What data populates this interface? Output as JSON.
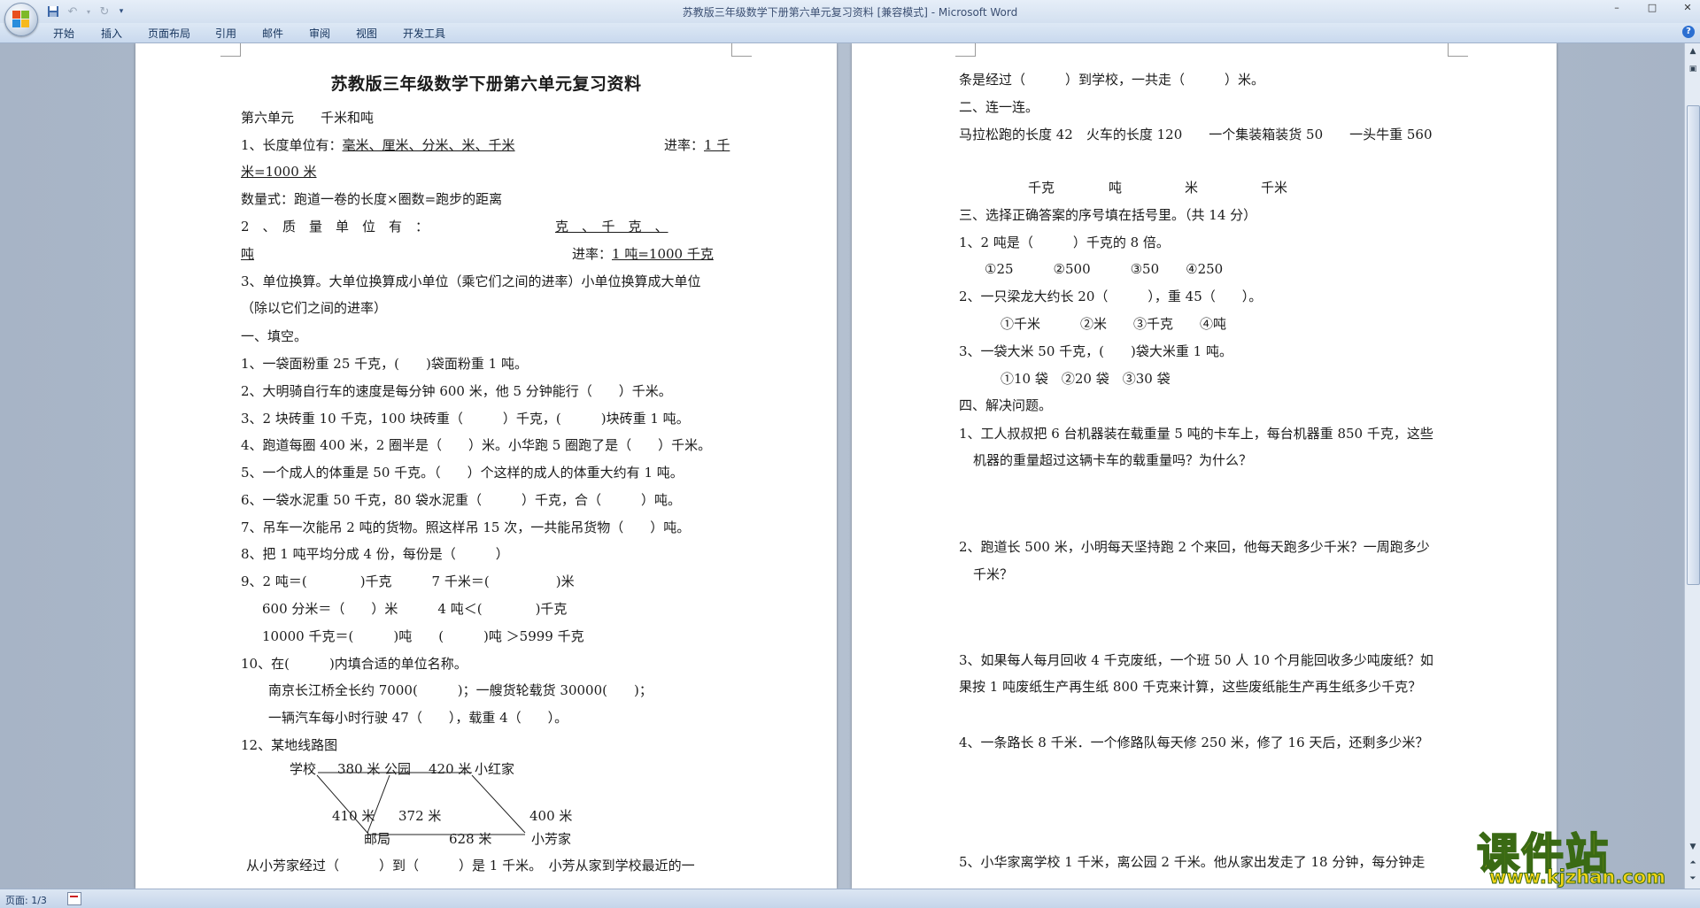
{
  "window": {
    "title": "苏教版三年级数学下册第六单元复习资料 [兼容模式] - Microsoft Word",
    "controls": [
      "–",
      "□",
      "✕"
    ]
  },
  "ribbon": {
    "tabs": [
      "开始",
      "插入",
      "页面布局",
      "引用",
      "邮件",
      "审阅",
      "视图",
      "开发工具"
    ],
    "help_icon": "?"
  },
  "qat": {
    "save_icon": "save-icon",
    "undo_icon": "undo-icon",
    "redo_icon": "redo-icon",
    "more_icon": "customize-icon"
  },
  "status": {
    "page": "页面: 1/3"
  },
  "watermark": {
    "brand": "课件站",
    "url": "www.kjzhan.com"
  },
  "page1": {
    "title": "苏教版三年级数学下册第六单元复习资料",
    "unit_heading": "第六单元　　千米和吨",
    "len_units_label": "1、长度单位有：",
    "len_units": "毫米、厘米、分米、米、千米",
    "len_rate_label": "进率：",
    "len_rate_a": "1 千",
    "len_rate_b": "米=1000 米",
    "formula": "数量式：跑道一卷的长度×圈数=跑步的距离",
    "mass_prefix": "2　、　质　量　单　位　有　：",
    "mass_units_a": "克　、　千　克　、",
    "mass_units_b": "吨",
    "mass_rate_label": "进率：",
    "mass_rate": "1 吨=1000 千克",
    "conv_a": "3、单位换算。大单位换算成小单位（乘它们之间的进率）小单位换算成大单位",
    "conv_b": "（除以它们之间的进率）",
    "sec1": "一、填空。",
    "q1": "1、一袋面粉重 25 千克，(　　)袋面粉重 1 吨。",
    "q2": "2、大明骑自行车的速度是每分钟 600 米，他 5 分钟能行（　　）千米。",
    "q3": "3、2 块砖重 10 千克，100 块砖重（　　　）千克，(　　　)块砖重 1 吨。",
    "q4": "4、跑道每圈 400 米，2 圈半是（　　）米。小华跑 5 圈跑了是（　　）千米。",
    "q5": "5、一个成人的体重是 50 千克。（　　）个这样的成人的体重大约有 1 吨。",
    "q6": "6、一袋水泥重 50 千克，80 袋水泥重（　　　）千克，合（　　　）吨。",
    "q7": "7、吊车一次能吊 2 吨的货物。照这样吊 15 次，一共能吊货物（　　）吨。",
    "q8": "8、把 1 吨平均分成 4 份，每份是（　　　）",
    "q9a": "9、2 吨＝(　　　　)千克　　　7 千米＝(　　　　　)米",
    "q9b": "600 分米＝（　　）米　　　4 吨＜(　　　　)千克",
    "q9c": "10000 千克＝(　　　)吨　　(　　　)吨 ＞5999 千克",
    "q10": "10、在(　　　)内填合适的单位名称。",
    "q10a": "南京长江桥全长约 7000(　　　)；一艘货轮载货 30000(　　)；",
    "q10b": "一辆汽车每小时行驶 47（　　），载重 4（　　）。",
    "q12": "12、某地线路图",
    "map": {
      "school": "学校",
      "park": "公园",
      "xiaohong": "小红家",
      "post": "邮局",
      "xiaofang": "小芳家",
      "d_school_park": "380 米",
      "d_park_hong": "420 米",
      "d_school_post": "410 米",
      "d_park_post": "372 米",
      "d_hong_fang": "400 米",
      "d_post_fang": "628 米"
    },
    "last": "从小芳家经过（　　　）到（　　　）是 1 千米。　小芳从家到学校最近的一"
  },
  "page2": {
    "l1": "条是经过（　　　）到学校，一共走（　　　）米。",
    "sec2": "二、连一连。",
    "match_row": "马拉松跑的长度 42　火车的长度 120　　一个集装箱装货 50　　一头牛重 560",
    "match_units": [
      "千克",
      "吨",
      "米",
      "千米"
    ],
    "sec3": "三、选择正确答案的序号填在括号里。（共 14 分）",
    "c1": "1、2 吨是（　　　）千克的 8 倍。",
    "c1_opts": "①25　　　②500　　　③50　　④250",
    "c2": "2、一只梁龙大约长 20（　　　），重 45（　　）。",
    "c2_opts": "①千米　　　②米　　③千克　　④吨",
    "c3": "3、一袋大米 50 千克，(　　)袋大米重 1 吨。",
    "c3_opts": "①10 袋　②20 袋　③30 袋",
    "sec4": "四、解决问题。",
    "p1a": "1、工人叔叔把 6 台机器装在载重量 5 吨的卡车上，每台机器重 850 千克，这些",
    "p1b": "机器的重量超过这辆卡车的载重量吗？为什么？",
    "p2a": "2、跑道长 500 米，小明每天坚持跑 2 个来回，他每天跑多少千米？一周跑多少",
    "p2b": "千米？",
    "p3a": "3、如果每人每月回收 4 千克废纸，一个班 50 人 10 个月能回收多少吨废纸？如",
    "p3b": "果按 1 吨废纸生产再生纸 800 千克来计算，这些废纸能生产再生纸多少千克？",
    "p4": "4、一条路长 8 千米．一个修路队每天修 250 米，修了 16 天后，还剩多少米？",
    "p5": "5、小华家离学校 1 千米，离公园 2 千米。他从家出发走了 18 分钟，每分钟走"
  }
}
